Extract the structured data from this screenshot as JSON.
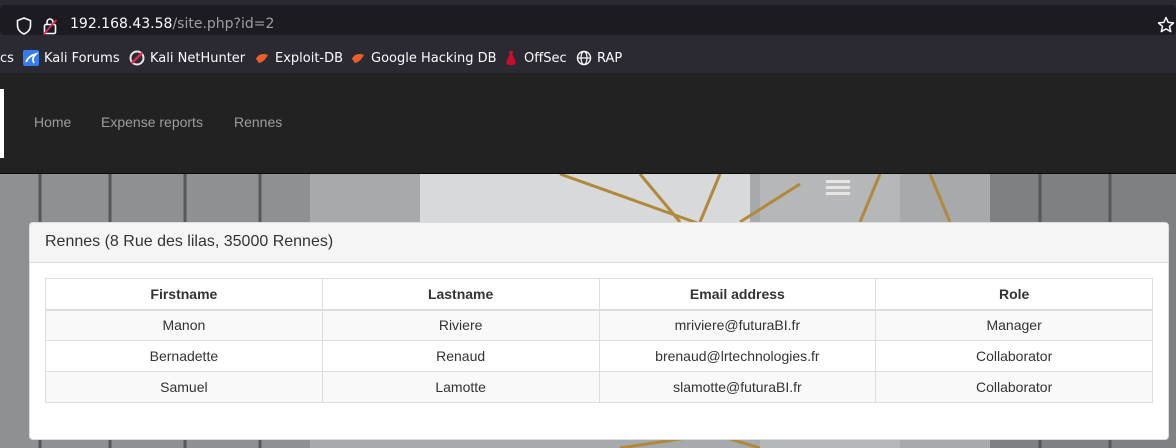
{
  "browser": {
    "url_host": "192.168.43.58",
    "url_path": "/site.php?id=2",
    "bookmarks": [
      {
        "label": "cs",
        "icon": "bookmark-cs"
      },
      {
        "label": "Kali Forums",
        "icon": "kali-dragon-icon"
      },
      {
        "label": "Kali NetHunter",
        "icon": "nethunter-icon"
      },
      {
        "label": "Exploit-DB",
        "icon": "exploit-db-icon"
      },
      {
        "label": "Google Hacking DB",
        "icon": "ghdb-icon"
      },
      {
        "label": "OffSec",
        "icon": "offsec-icon"
      },
      {
        "label": "RAP",
        "icon": "globe-icon"
      }
    ]
  },
  "nav": {
    "links": [
      "Home",
      "Expense reports",
      "Rennes"
    ],
    "link_color": "#9d9d9d",
    "background": "#222222"
  },
  "panel": {
    "title": "Rennes (8 Rue des lilas, 35000 Rennes)",
    "table": {
      "headers": [
        "Firstname",
        "Lastname",
        "Email address",
        "Role"
      ],
      "rows": [
        [
          "Manon",
          "Riviere",
          "mriviere@futuraBI.fr",
          "Manager"
        ],
        [
          "Bernadette",
          "Renaud",
          "brenaud@lrtechnologies.fr",
          "Collaborator"
        ],
        [
          "Samuel",
          "Lamotte",
          "slamotte@futuraBI.fr",
          "Collaborator"
        ]
      ]
    }
  }
}
